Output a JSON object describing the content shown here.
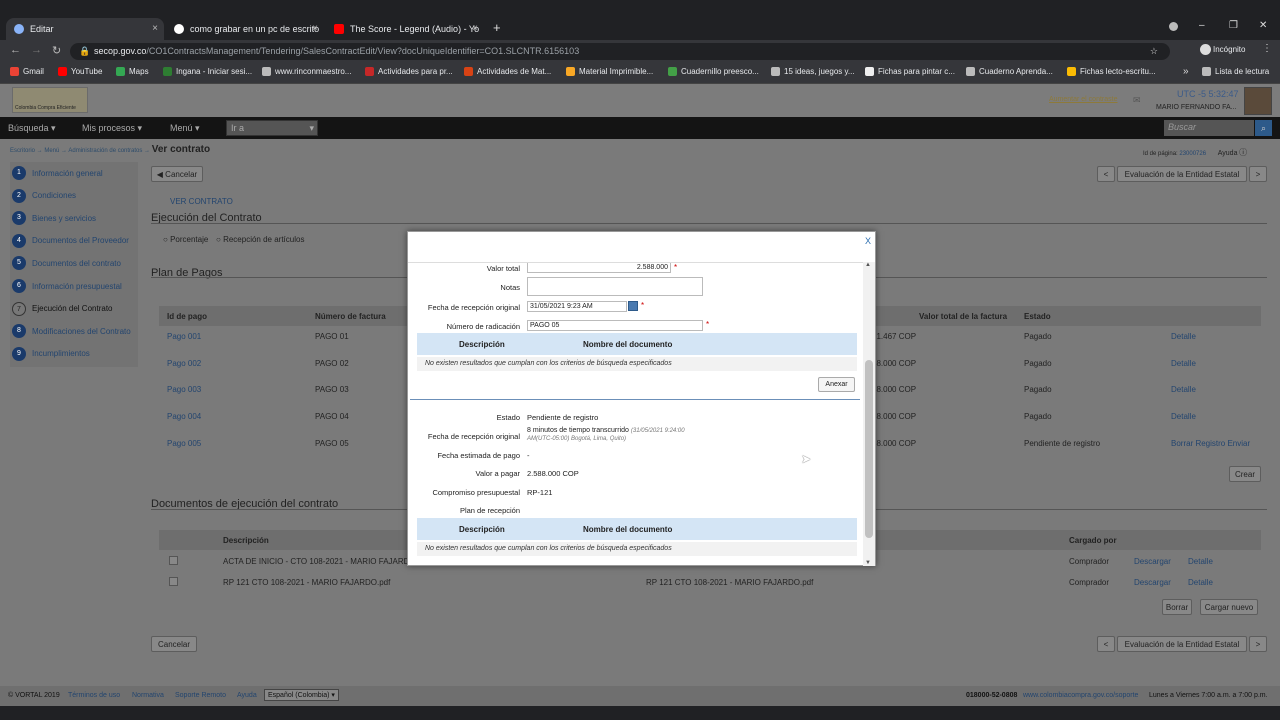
{
  "browser": {
    "tabs": [
      {
        "title": "Editar",
        "close": "×"
      },
      {
        "title": "como grabar en un pc de escrito",
        "close": "×"
      },
      {
        "title": "The Score - Legend (Audio) - Yo",
        "close": "×"
      }
    ],
    "new_tab": "+",
    "url_host": "secop.gov.co",
    "url_path": "/CO1ContractsManagement/Tendering/SalesContractEdit/View?docUniqueIdentifier=CO1.SLCNTR.6156103",
    "incognito_label": "Incógnito",
    "window_controls": [
      "–",
      "❐",
      "✕"
    ],
    "bookmarks": [
      {
        "label": "Gmail",
        "color": "#ea4335"
      },
      {
        "label": "YouTube",
        "color": "#ff0000"
      },
      {
        "label": "Maps",
        "color": "#34a853"
      },
      {
        "label": "Ingana - Iniciar sesi...",
        "color": "#2e7d32"
      },
      {
        "label": "www.rinconmaestro...",
        "color": "#bbbbbb"
      },
      {
        "label": "Actividades para pr...",
        "color": "#c62828"
      },
      {
        "label": "Actividades de Mat...",
        "color": "#d84315"
      },
      {
        "label": "Material Imprimible...",
        "color": "#f9a825"
      },
      {
        "label": "Cuadernillo preesco...",
        "color": "#43a047"
      },
      {
        "label": "15 ideas, juegos y...",
        "color": "#bbbbbb"
      },
      {
        "label": "Fichas para pintar c...",
        "color": "#eeeeee"
      },
      {
        "label": "Cuaderno Aprenda...",
        "color": "#bbbbbb"
      },
      {
        "label": "Fichas lecto-escritu...",
        "color": "#fbbc04"
      }
    ],
    "more_bookmarks": "»",
    "reading_list": "Lista de lectura"
  },
  "header": {
    "logo_text": "Colombia Compra Eficiente",
    "time": "UTC -5 5:32:47",
    "user": "MARIO FERNANDO FA...",
    "feedback": "Aumentar el contraste"
  },
  "topnav": {
    "items": [
      "Búsqueda ▾",
      "Mis procesos ▾",
      "Menú ▾"
    ],
    "go_to": "Ir a",
    "search_placeholder": "Buscar"
  },
  "breadcrumb": {
    "path": "Escritorio → Menú → Administración de contratos →",
    "current": "Ver contrato",
    "page_id_label": "Id de página:",
    "page_id": "23000726",
    "help": "Ayuda"
  },
  "sidebar": {
    "items": [
      {
        "n": "1",
        "label": "Información general"
      },
      {
        "n": "2",
        "label": "Condiciones"
      },
      {
        "n": "3",
        "label": "Bienes y servicios"
      },
      {
        "n": "4",
        "label": "Documentos del Proveedor"
      },
      {
        "n": "5",
        "label": "Documentos del contrato"
      },
      {
        "n": "6",
        "label": "Información presupuestal"
      },
      {
        "n": "7",
        "label": "Ejecución del Contrato"
      },
      {
        "n": "8",
        "label": "Modificaciones del Contrato"
      },
      {
        "n": "9",
        "label": "Incumplimientos"
      }
    ]
  },
  "main": {
    "cancel": "Cancelar",
    "nav_prev": "<",
    "nav_next": ">",
    "next_step": "Evaluación de la Entidad Estatal",
    "ver_contrato": "VER CONTRATO",
    "section_title": "Ejecución del Contrato",
    "radio_pct": "Porcentaje",
    "radio_items": "Recepción de artículos",
    "plan_title": "Plan de Pagos",
    "plan_cols": [
      "Id de pago",
      "Número de factura",
      "Valor total de la factura",
      "Estado"
    ],
    "payments": [
      {
        "id": "Pago 001",
        "factura": "PAGO 01",
        "valor": "21.467 COP",
        "estado": "Pagado",
        "action": "Detalle"
      },
      {
        "id": "Pago 002",
        "factura": "PAGO 02",
        "valor": "88.000 COP",
        "estado": "Pagado",
        "action": "Detalle"
      },
      {
        "id": "Pago 003",
        "factura": "PAGO 03",
        "valor": "88.000 COP",
        "estado": "Pagado",
        "action": "Detalle"
      },
      {
        "id": "Pago 004",
        "factura": "PAGO 04",
        "valor": "88.000 COP",
        "estado": "Pagado",
        "action": "Detalle"
      },
      {
        "id": "Pago 005",
        "factura": "PAGO 05",
        "valor": "88.000 COP",
        "estado": "Pendiente de registro",
        "action": "Borrar Registro Enviar"
      }
    ],
    "crear": "Crear",
    "docs_title": "Documentos de ejecución del contrato",
    "docs_cols": [
      "Descripción",
      "Cargado por"
    ],
    "docs": [
      {
        "desc": "ACTA DE INICIO - CTO 108-2021 - MARIO FAJARDO",
        "file": "",
        "by": "Comprador",
        "dl": "Descargar",
        "det": "Detalle"
      },
      {
        "desc": "RP 121 CTO 108-2021 - MARIO FAJARDO.pdf",
        "file": "RP 121 CTO 108-2021 - MARIO FAJARDO.pdf",
        "by": "Comprador",
        "dl": "Descargar",
        "det": "Detalle"
      }
    ],
    "borrar": "Borrar",
    "cargar_nuevo": "Cargar nuevo"
  },
  "modal": {
    "close": "X",
    "valor_total_label": "Valor total",
    "valor_total": "2.588.000",
    "notas_label": "Notas",
    "fecha_label": "Fecha de recepción original",
    "fecha": "31/05/2021 9:23 AM",
    "radicacion_label": "Número de radicación",
    "radicacion": "PAGO 05",
    "doc_col_desc": "Descripción",
    "doc_col_name": "Nombre del documento",
    "no_results": "No existen resultados que cumplan con los criterios de búsqueda especificados",
    "anexar": "Anexar",
    "estado_label": "Estado",
    "estado": "Pendiente de registro",
    "fecha2_label": "Fecha de recepción original",
    "fecha2": "8 minutos de tiempo transcurrido",
    "fecha2_detail": "(31/05/2021 9:24:00",
    "fecha2_tz": "AM(UTC-05:00) Bogotá, Lima, Quito)",
    "fecha_est_label": "Fecha estimada de pago",
    "fecha_est": "-",
    "valor_pagar_label": "Valor a pagar",
    "valor_pagar": "2.588.000 COP",
    "compromiso_label": "Compromiso presupuestal",
    "compromiso": "RP-121",
    "plan_recepcion_label": "Plan de recepción",
    "required": "*"
  },
  "footer": {
    "copyright": "© VORTAL 2019",
    "links": [
      "Términos de uso",
      "Normativa",
      "Soporte Remoto",
      "Ayuda"
    ],
    "lang": "Español (Colombia) ▾",
    "phone": "018000-52-0808",
    "site": "www.colombiacompra.gov.co/soporte",
    "hours": "Lunes a Viernes 7:00 a.m. a 7:00 p.m."
  },
  "colors": {
    "accent": "#23456f",
    "modal_header": "#d4e5f5",
    "required": "#cc0000"
  }
}
